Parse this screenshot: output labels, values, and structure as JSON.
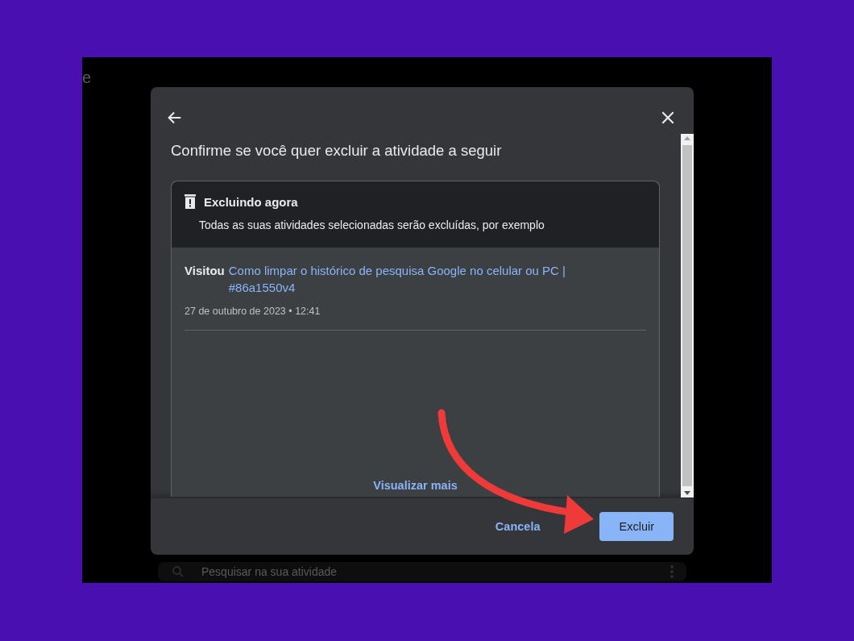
{
  "background_page": {
    "heading_fragment": "e",
    "search": {
      "placeholder": "Pesquisar na sua atividade"
    }
  },
  "dialog": {
    "title": "Confirme se você quer excluir a atividade a seguir",
    "notice": {
      "heading": "Excluindo agora",
      "text": "Todas as suas atividades selecionadas serão excluídas, por exemplo"
    },
    "activity": {
      "verb": "Visitou",
      "link": "Como limpar o histórico de pesquisa Google no celular ou PC | #86a1550v4",
      "date": "27 de outubro de 2023 • 12:41"
    },
    "more_link": "Visualizar mais",
    "buttons": [
      {
        "label": "Cancela",
        "kind": "text"
      },
      {
        "label": "Excluir",
        "kind": "primary"
      }
    ]
  }
}
